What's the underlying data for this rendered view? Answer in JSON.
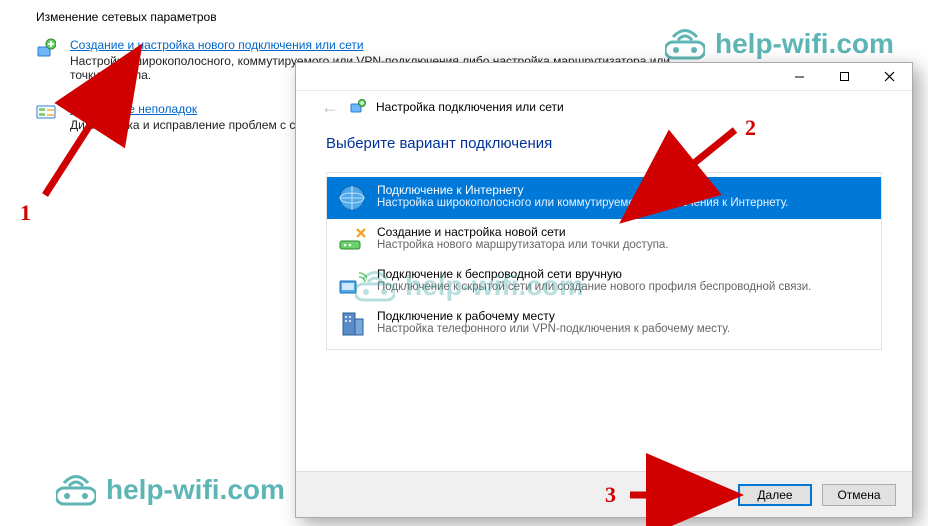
{
  "bg": {
    "heading": "Изменение сетевых параметров",
    "items": [
      {
        "link": "Создание и настройка нового подключения или сети",
        "desc": "Настройка широкополосного, коммутируемого или VPN-подключения либо настройка маршрутизатора или точки доступа."
      },
      {
        "link": "Устранение неполадок",
        "desc": "Диагностика и исправление проблем с сетью или получение сведений об устранении неполадок."
      }
    ]
  },
  "modal": {
    "crumb": "Настройка подключения или сети",
    "title": "Выберите вариант подключения",
    "options": [
      {
        "title": "Подключение к Интернету",
        "desc": "Настройка широкополосного или коммутируемого подключения к Интернету.",
        "selected": true
      },
      {
        "title": "Создание и настройка новой сети",
        "desc": "Настройка нового маршрутизатора или точки доступа."
      },
      {
        "title": "Подключение к беспроводной сети вручную",
        "desc": "Подключение к скрытой сети или создание нового профиля беспроводной связи."
      },
      {
        "title": "Подключение к рабочему месту",
        "desc": "Настройка телефонного или VPN-подключения к рабочему месту."
      }
    ],
    "buttons": {
      "next": "Далее",
      "cancel": "Отмена"
    }
  },
  "watermark": "help-wifi.com",
  "annotations": {
    "n1": "1",
    "n2": "2",
    "n3": "3"
  },
  "colors": {
    "accent": "#0078d7",
    "link": "#0066cc",
    "title": "#003399",
    "anno": "#d00000",
    "brand": "#37a3a3"
  }
}
